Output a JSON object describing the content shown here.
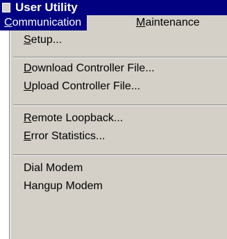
{
  "window": {
    "title": "User Utility"
  },
  "menubar": {
    "items": [
      {
        "label": "Communication",
        "mnemonic": "C",
        "rest": "ommunication"
      },
      {
        "label": "Maintenance",
        "mnemonic": "M",
        "rest": "aintenance"
      }
    ]
  },
  "dropdown": {
    "items": [
      {
        "mnemonic": "S",
        "rest": "etup..."
      },
      {
        "mnemonic": "D",
        "rest": "ownload Controller File..."
      },
      {
        "mnemonic": "U",
        "rest": "pload Controller File..."
      },
      {
        "mnemonic": "R",
        "rest": "emote Loopback..."
      },
      {
        "mnemonic": "E",
        "rest": "rror Statistics..."
      },
      {
        "label": "Dial Modem"
      },
      {
        "label": "Hangup Modem"
      }
    ]
  },
  "icons": {
    "app": "app-window-icon"
  },
  "colors": {
    "titlebar": "#000080",
    "menu_bg": "#d4d0c8",
    "highlight": "#000080"
  }
}
